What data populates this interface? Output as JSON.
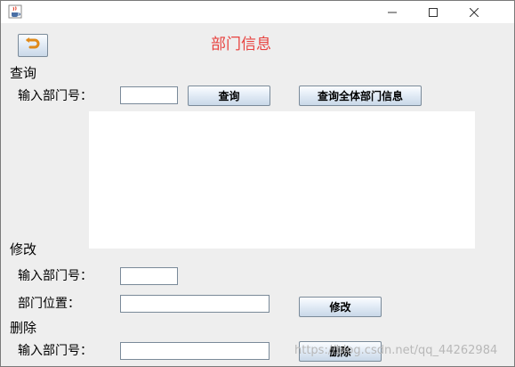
{
  "window": {
    "title_icon": "java-cup-icon",
    "minimize_icon": "minimize-icon",
    "maximize_icon": "maximize-icon",
    "close_icon": "close-icon"
  },
  "header": {
    "back_icon": "undo-arrow-icon",
    "title": "部门信息"
  },
  "query": {
    "section_label": "查询",
    "dept_no_label": "输入部门号：",
    "dept_no_value": "",
    "query_button": "查询",
    "query_all_button": "查询全体部门信息",
    "results_text": ""
  },
  "modify": {
    "section_label": "修改",
    "dept_no_label": "输入部门号：",
    "dept_no_value": "",
    "location_label": "部门位置：",
    "location_value": "",
    "modify_button": "修改"
  },
  "delete": {
    "section_label": "删除",
    "dept_no_label": "输入部门号：",
    "dept_no_value": "",
    "delete_button": "删除"
  },
  "watermark": "https://blog.csdn.net/qq_44262984",
  "colors": {
    "title": "#e8423f",
    "window_bg": "#eeeeee",
    "button_border": "#7a8a99"
  }
}
